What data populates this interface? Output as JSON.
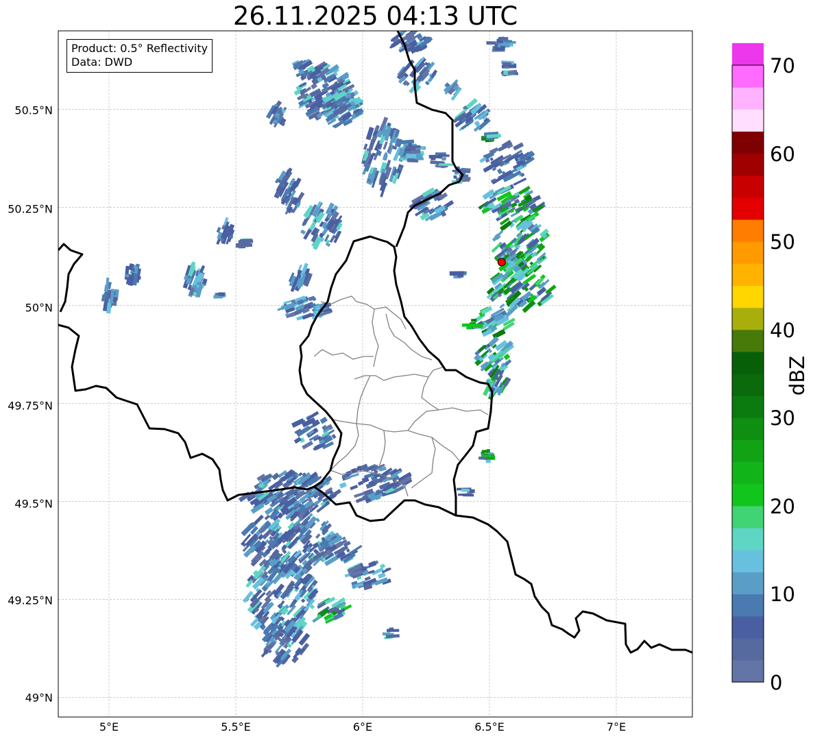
{
  "map": {
    "title": "26.11.2025 04:13 UTC",
    "info_box": {
      "product_line": "Product: 0.5° Reflectivity",
      "data_line": "Data: DWD"
    },
    "lat_labels": [
      "50.5°N",
      "50.25°N",
      "50°N",
      "49.75°N",
      "49.5°N",
      "49.25°N",
      "49°N"
    ],
    "lon_labels": [
      "5°E",
      "5.5°E",
      "6°E",
      "6.5°E",
      "7°E"
    ],
    "extent": {
      "lon_min": 4.8,
      "lon_max": 7.3,
      "lat_min": 48.95,
      "lat_max": 50.7
    },
    "radar_site": {
      "lon": 6.548,
      "lat": 50.11,
      "color": "#ff0000"
    },
    "colors": {
      "border": "#000000",
      "internal_border": "#808080",
      "grid": "#b0b0b0"
    }
  },
  "colorbar": {
    "label": "dBZ",
    "ticks": [
      "70",
      "60",
      "50",
      "40",
      "30",
      "20",
      "10",
      "0"
    ],
    "vmin": 0,
    "vmax": 70,
    "bin_size": 2.5,
    "colors": [
      "#6374a6",
      "#566aa0",
      "#4a5fa1",
      "#4a7ab0",
      "#5a9ec8",
      "#67c1de",
      "#5fd5c4",
      "#40d474",
      "#12c51c",
      "#12b519",
      "#12a315",
      "#0e8f12",
      "#0b7b10",
      "#0a6a0c",
      "#076008",
      "#477a09",
      "#a8af0c",
      "#ffd600",
      "#ffb300",
      "#ff9a00",
      "#ff7d00",
      "#e40000",
      "#c90000",
      "#a10000",
      "#7f0000",
      "#ffdeff",
      "#ffb3ff",
      "#ff6aff",
      "#ec37ec"
    ]
  }
}
